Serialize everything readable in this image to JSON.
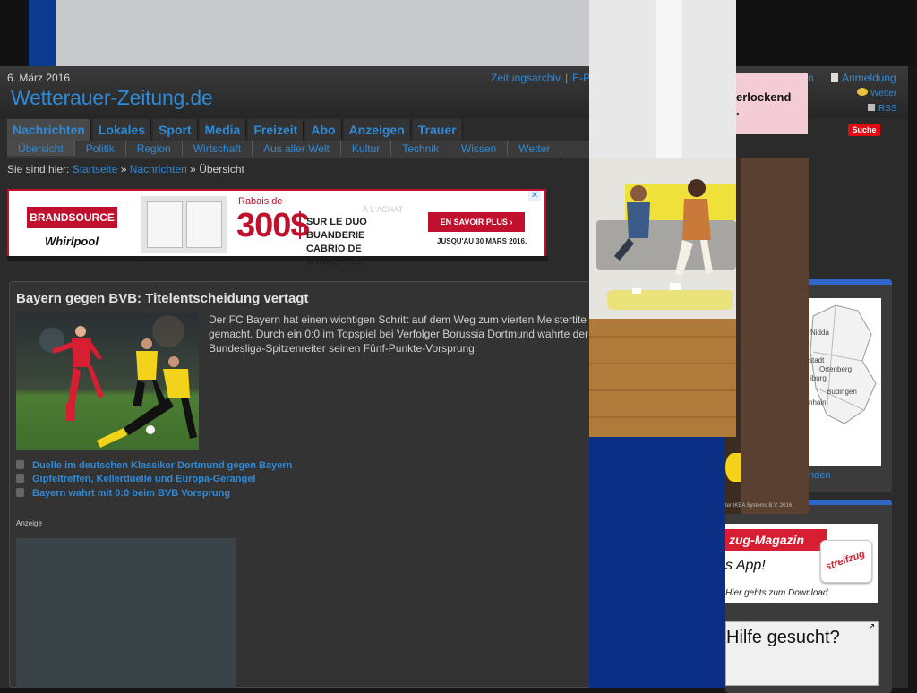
{
  "header": {
    "date": "6. März 2016",
    "logo": "Wetterauer-Zeitung.de",
    "toplinks": [
      "Zeitungsarchiv",
      "E-Pa"
    ],
    "anmeldung": "Anmeldung",
    "wetter": "Wetter",
    "rss": "RSS",
    "suche": "Suche"
  },
  "nav": {
    "main": [
      "Nachrichten",
      "Lokales",
      "Sport",
      "Media",
      "Freizeit",
      "Abo",
      "Anzeigen",
      "Trauer"
    ],
    "sub": [
      "Übersicht",
      "Politik",
      "Region",
      "Wirtschaft",
      "Aus aller Welt",
      "Kultur",
      "Technik",
      "Wissen",
      "Wetter"
    ]
  },
  "breadcrumb": {
    "prefix": "Sie sind hier:",
    "items": [
      "Startseite",
      "Nachrichten",
      "Übersicht"
    ],
    "sep": "»"
  },
  "ad_banner": {
    "brand": "BRANDSOURCE",
    "sub_brand": "Whirlpool",
    "rabais": "Rabais de",
    "amount": "300$",
    "offer": "SUR LE DUO BUANDERIE CABRIO DE WHIRLPOOL",
    "faint": "À L'ACHAT",
    "cta": "EN SAVOIR PLUS",
    "until": "JUSQU'AU 30 MARS 2016."
  },
  "article": {
    "headline": "Bayern gegen BVB: Titelentscheidung vertagt",
    "teaser_lines": [
      "Der FC Bayern hat einen wichtigen Schritt auf dem Weg zum vierten Meistertite",
      "gemacht. Durch ein 0:0 im Topspiel bei Verfolger Borussia Dortmund wahrte der",
      "Bundesliga-Spitzenreiter seinen Fünf-Punkte-Vorsprung."
    ],
    "related": [
      "Duelle im deutschen Klassiker Dortmund gegen Bayern",
      "Gipfeltreffen, Kellerduelle und Europa-Gerangel",
      "Bayern wahrt mit 0:0 beim BVB Vorsprung"
    ],
    "anzeige": "Anzeige"
  },
  "right": {
    "pink_ad_lines": [
      "erlockend",
      "."
    ],
    "map_places": [
      "Nidda",
      "stadt",
      "Ortenberg",
      "iburg",
      "Büdingen",
      "nhain"
    ],
    "map_link": "nden",
    "ikea_copyright": "ter IKEA Systems B.V. 2016",
    "magazin_title": "zug-Magazin",
    "magazin_app": "s App!",
    "magazin_download": "Hier gehts zum Download",
    "magazin_brand": "streifzug",
    "help": "Hilfe gesucht?"
  }
}
